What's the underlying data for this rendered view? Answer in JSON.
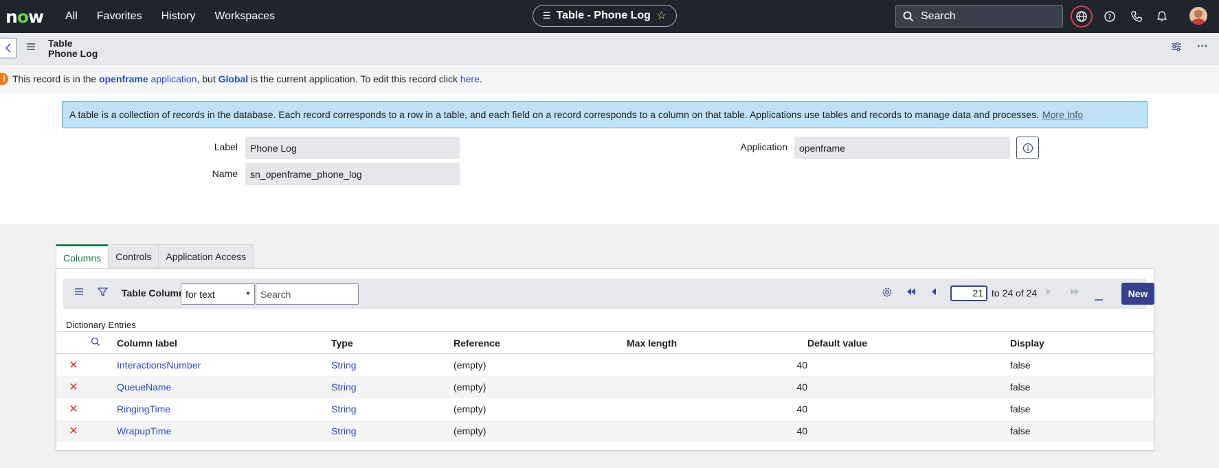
{
  "nav": {
    "logo_text": "now",
    "links": [
      "All",
      "Favorites",
      "History",
      "Workspaces"
    ],
    "title": "Table - Phone Log",
    "search_placeholder": "Search"
  },
  "header": {
    "title_line1": "Table",
    "title_line2": "Phone Log"
  },
  "warning": {
    "part1": "This record is in the ",
    "app_name": "openframe",
    "app_word": " application",
    "part2": ", but ",
    "current_app": "Global",
    "part3": " is the current application. To edit this record click ",
    "link": "here",
    "part4": "."
  },
  "info": {
    "text": "A table is a collection of records in the database. Each record corresponds to a row in a table, and each field on a record corresponds to a column on that table. Applications use tables and records to manage data and processes.",
    "more_link": "More Info"
  },
  "form": {
    "label_label": "Label",
    "label_value": "Phone Log",
    "name_label": "Name",
    "name_value": "sn_openframe_phone_log",
    "application_label": "Application",
    "application_value": "openframe"
  },
  "tabs": [
    "Columns",
    "Controls",
    "Application Access"
  ],
  "list": {
    "title": "Table Columns",
    "filter_select": "for text",
    "search_placeholder": "Search",
    "page_value": "21",
    "page_range": "to 24 of 24",
    "new_label": "New",
    "dictionary_label": "Dictionary Entries",
    "headers": [
      "Column label",
      "Type",
      "Reference",
      "Max length",
      "Default value",
      "Display"
    ],
    "rows": [
      {
        "label": "InteractionsNumber",
        "type": "String",
        "reference": "(empty)",
        "max_length": "40",
        "default_value": "",
        "display": "false"
      },
      {
        "label": "QueueName",
        "type": "String",
        "reference": "(empty)",
        "max_length": "40",
        "default_value": "",
        "display": "false"
      },
      {
        "label": "RingingTime",
        "type": "String",
        "reference": "(empty)",
        "max_length": "40",
        "default_value": "",
        "display": "false"
      },
      {
        "label": "WrapupTime",
        "type": "String",
        "reference": "(empty)",
        "max_length": "40",
        "default_value": "",
        "display": "false"
      }
    ]
  },
  "icons": {
    "search": "search-icon",
    "globe": "globe-icon",
    "help": "help-icon",
    "phone": "phone-icon",
    "bell": "bell-icon",
    "star": "star-icon"
  },
  "colors": {
    "nav_bg": "#20242d",
    "accent": "#35418c",
    "link": "#2b4ab7",
    "delete": "#d93434",
    "active_tab": "#1c7a4f",
    "info_bg": "#bfe2f8",
    "warn": "#f27b21"
  }
}
